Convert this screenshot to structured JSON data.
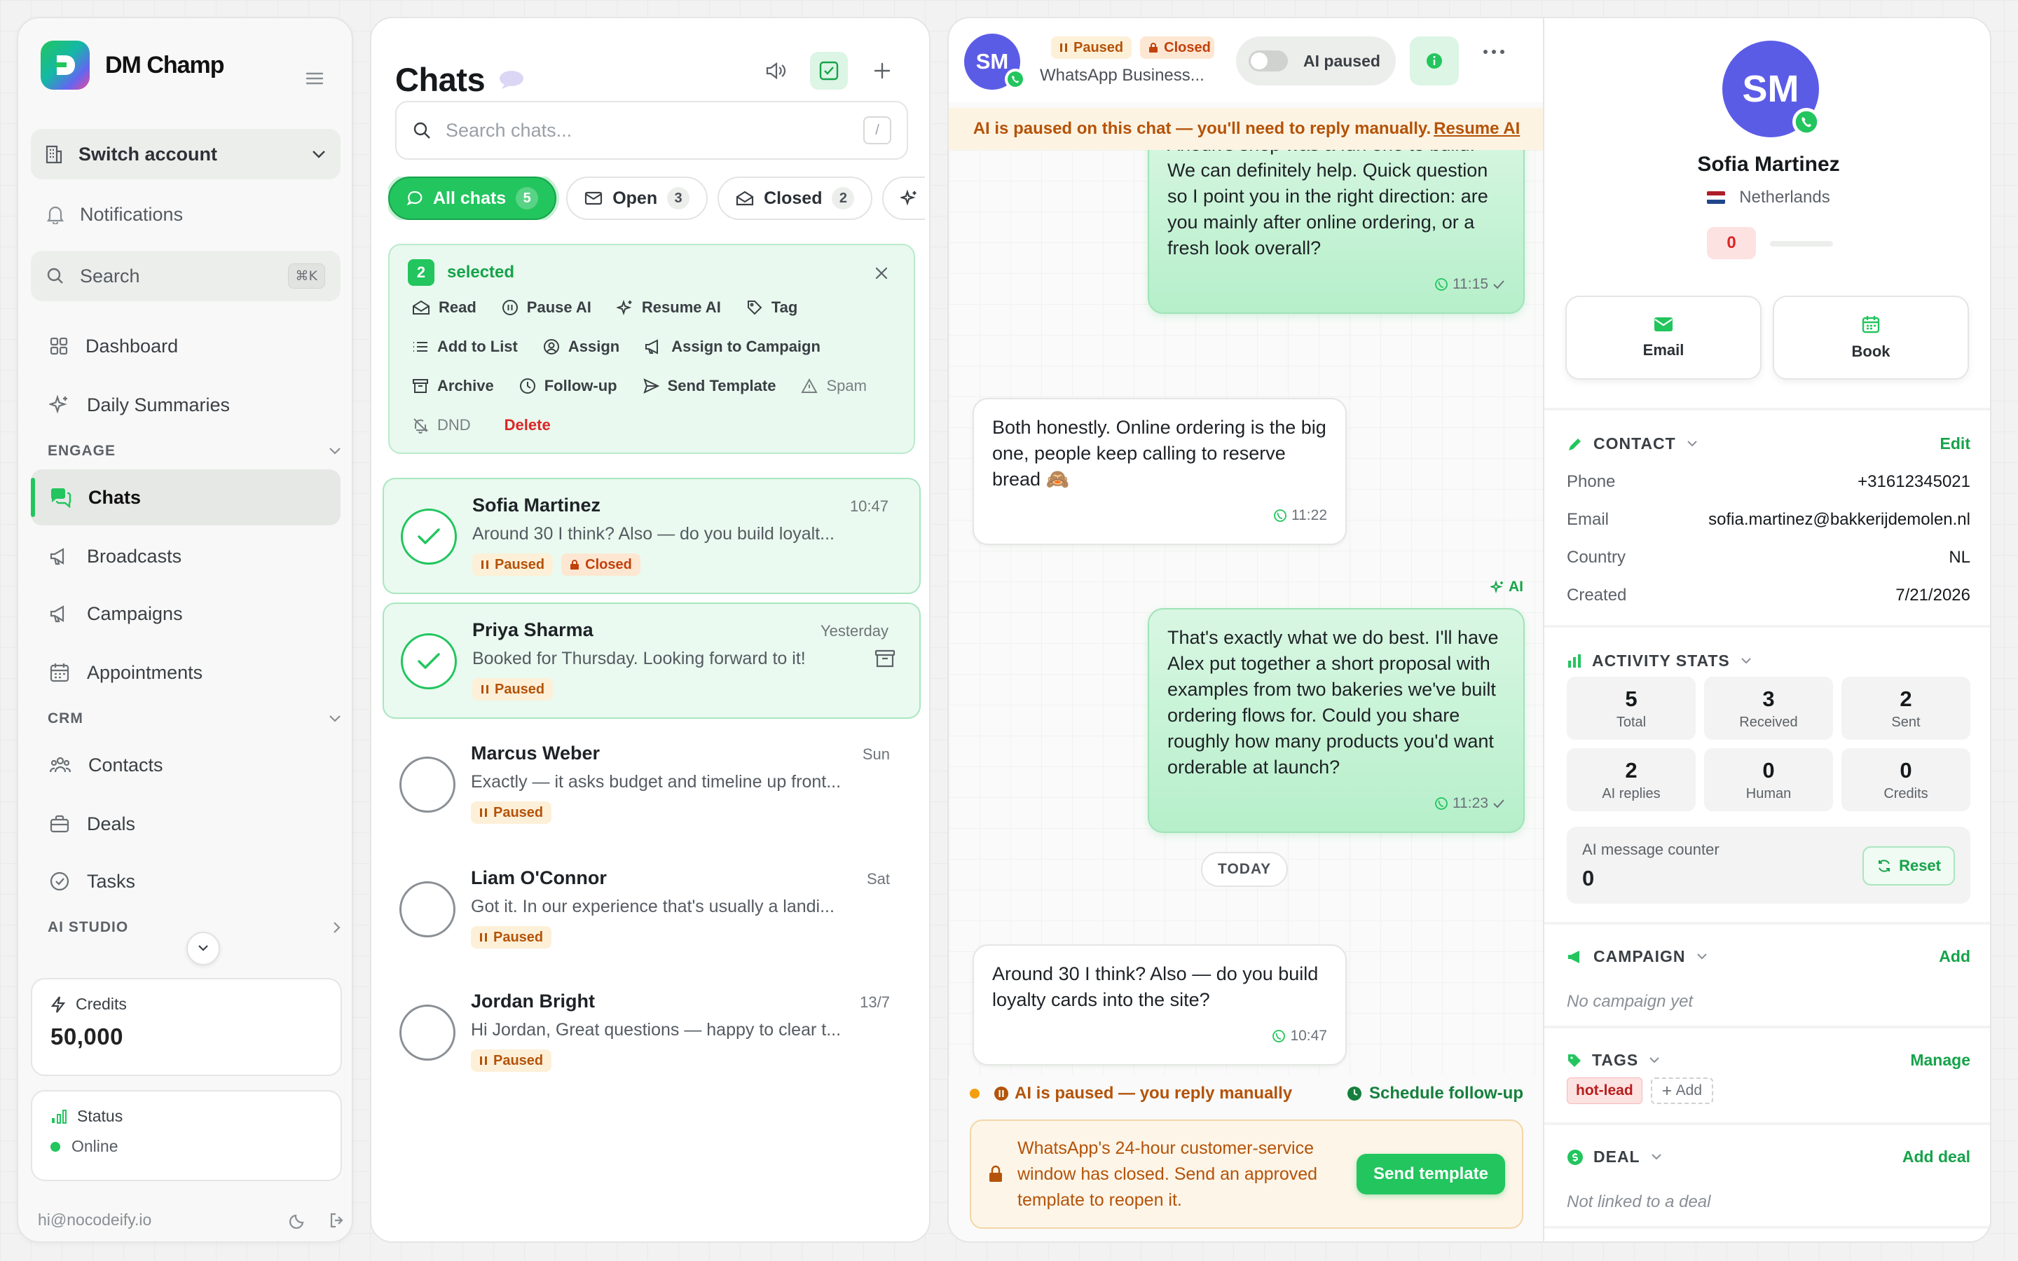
{
  "brand": {
    "name": "DM Champ"
  },
  "sidebar": {
    "switch_account": "Switch account",
    "notifications": "Notifications",
    "search": {
      "label": "Search",
      "shortcut": "⌘K"
    },
    "dashboard": "Dashboard",
    "daily_summaries": "Daily Summaries",
    "section_engage": "ENGAGE",
    "chats": "Chats",
    "broadcasts": "Broadcasts",
    "campaigns": "Campaigns",
    "appointments": "Appointments",
    "section_crm": "CRM",
    "contacts": "Contacts",
    "deals": "Deals",
    "tasks": "Tasks",
    "section_ai_studio": "AI STUDIO",
    "credits_label": "Credits",
    "credits_value": "50,000",
    "status_label": "Status",
    "status_value": "Online",
    "user_email": "hi@nocodeify.io"
  },
  "chatlist": {
    "title": "Chats",
    "search_placeholder": "Search chats...",
    "search_shortcut": "/",
    "filters": [
      {
        "label": "All chats",
        "count": "5"
      },
      {
        "label": "Open",
        "count": "3"
      },
      {
        "label": "Closed",
        "count": "2"
      }
    ],
    "bulk": {
      "count": "2",
      "label": "selected",
      "actions": [
        "Read",
        "Pause AI",
        "Resume AI",
        "Tag",
        "Add to List",
        "Assign",
        "Assign to Campaign",
        "Archive",
        "Follow-up",
        "Send Template",
        "Spam",
        "DND",
        "Delete"
      ]
    },
    "items": [
      {
        "name": "Sofia Martinez",
        "time": "10:47",
        "preview": "Around 30 I think? Also — do you build loyalt...",
        "paused": "Paused",
        "closed": "Closed"
      },
      {
        "name": "Priya Sharma",
        "time": "Yesterday",
        "preview": "Booked for Thursday. Looking forward to it!",
        "paused": "Paused"
      },
      {
        "name": "Marcus Weber",
        "time": "Sun",
        "preview": "Exactly — it asks budget and timeline up front...",
        "paused": "Paused"
      },
      {
        "name": "Liam O'Connor",
        "time": "Sat",
        "preview": "Got it. In our experience that's usually a landi...",
        "paused": "Paused"
      },
      {
        "name": "Jordan Bright",
        "time": "13/7",
        "preview": "Hi Jordan, Great questions — happy to clear t...",
        "paused": "Paused"
      }
    ]
  },
  "conversation": {
    "avatar_initials": "SM",
    "pill_paused": "Paused",
    "pill_closed": "Closed",
    "channel": "WhatsApp Business...",
    "ai_toggle": "AI paused",
    "banner_text": "AI is paused on this chat — you'll need to reply manually.",
    "banner_link": "Resume AI",
    "messages": [
      {
        "text": "Anouk's shop was a fun one to build. We can definitely help. Quick question so I point you in the right direction: are you mainly after online ordering, or a fresh look overall?",
        "time": "11:15"
      },
      {
        "text": "Both honestly. Online ordering is the big one, people keep calling to reserve bread 🙈",
        "time": "11:22"
      },
      {
        "text": "That's exactly what we do best. I'll have Alex put together a short proposal with examples from two bakeries we've built ordering flows for. Could you share roughly how many products you'd want orderable at launch?",
        "time": "11:23"
      },
      {
        "text": "Around 30 I think? Also — do you build loyalty cards into the site?",
        "time": "10:47"
      }
    ],
    "ai_label": "AI",
    "today": "TODAY",
    "status_paused": "AI is paused — you reply manually",
    "schedule_followup": "Schedule follow-up",
    "window_notice": "WhatsApp's 24-hour customer-service window has closed. Send an approved template to reopen it.",
    "send_template": "Send template"
  },
  "contact": {
    "initials": "SM",
    "name": "Sofia Martinez",
    "country": "Netherlands",
    "score": "0",
    "action_email": "Email",
    "action_book": "Book",
    "contact_section": "CONTACT",
    "edit": "Edit",
    "fields": [
      {
        "key": "Phone",
        "value": "+31612345021"
      },
      {
        "key": "Email",
        "value": "sofia.martinez@bakkerijdemolen.nl"
      },
      {
        "key": "Country",
        "value": "NL"
      },
      {
        "key": "Created",
        "value": "7/21/2026"
      }
    ],
    "activity_section": "ACTIVITY STATS",
    "stats": [
      {
        "n": "5",
        "l": "Total"
      },
      {
        "n": "3",
        "l": "Received"
      },
      {
        "n": "2",
        "l": "Sent"
      },
      {
        "n": "2",
        "l": "AI replies"
      },
      {
        "n": "0",
        "l": "Human"
      },
      {
        "n": "0",
        "l": "Credits"
      }
    ],
    "counter_label": "AI message counter",
    "counter_value": "0",
    "reset": "Reset",
    "campaign_section": "CAMPAIGN",
    "campaign_add": "Add",
    "campaign_empty": "No campaign yet",
    "tags_section": "TAGS",
    "tags_manage": "Manage",
    "tag_hot": "hot-lead",
    "tag_add": "Add",
    "deal_section": "DEAL",
    "deal_add": "Add deal",
    "deal_empty": "Not linked to a deal"
  },
  "colors": {
    "accent": "#22c55e",
    "warning": "#b45309",
    "avatar": "#5b5ce6"
  }
}
